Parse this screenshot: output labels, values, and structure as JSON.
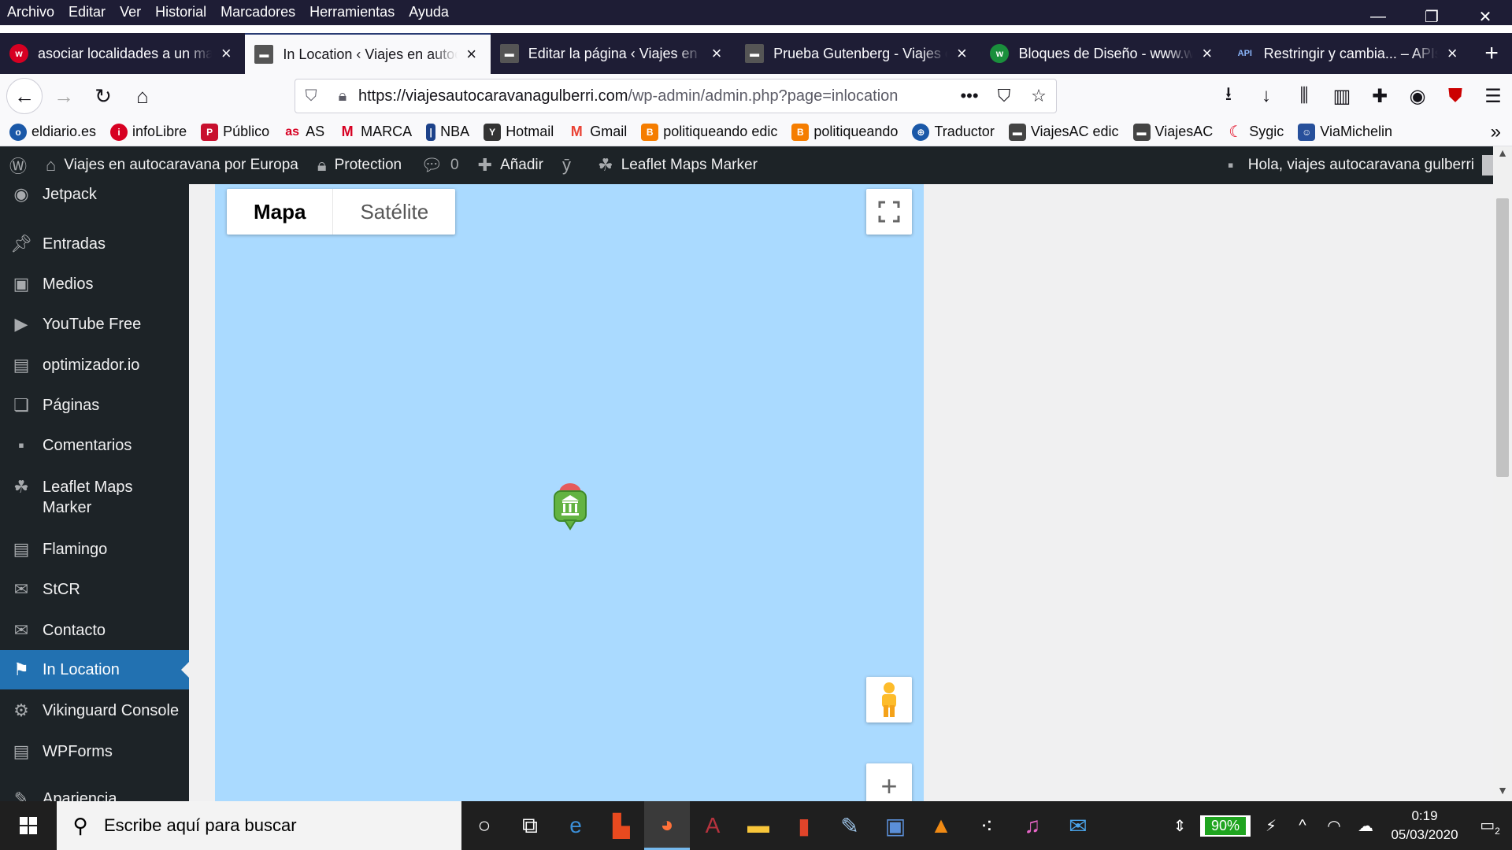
{
  "menubar": {
    "items": [
      "Archivo",
      "Editar",
      "Ver",
      "Historial",
      "Marcadores",
      "Herramientas",
      "Ayuda"
    ],
    "window_controls": [
      "minimize-icon",
      "restore-icon",
      "close-icon"
    ]
  },
  "tabs": [
    {
      "title": "asociar localidades a un mapa",
      "icon": "w-favicon",
      "color": "#d70022",
      "active": false
    },
    {
      "title": "In Location ‹ Viajes en autocaravana",
      "icon": "site-favicon",
      "color": "#555555",
      "active": true
    },
    {
      "title": "Editar la página ‹ Viajes en autocaravana",
      "icon": "site-favicon",
      "color": "#555555",
      "active": false
    },
    {
      "title": "Prueba Gutenberg - Viajes en autocaravana",
      "icon": "site-favicon",
      "color": "#555555",
      "active": false
    },
    {
      "title": "Bloques de Diseño - www.wpbeginner",
      "icon": "w-favicon",
      "color": "#1a8f3c",
      "active": false
    },
    {
      "title": "Restringir y cambia... – APIs",
      "icon": "api-favicon",
      "color": "#4a7bd4",
      "active": false
    }
  ],
  "navbar": {
    "url_domain": "https://viajesautocaravanagulberri.com",
    "url_path": "/wp-admin/admin.php?page=inlocation"
  },
  "bookmarks": [
    {
      "label": "eldiario.es",
      "color": "#1a58a8"
    },
    {
      "label": "infoLibre",
      "color": "#d70022"
    },
    {
      "label": "Público",
      "color": "#c8102e"
    },
    {
      "label": "AS",
      "color": "#d70022"
    },
    {
      "label": "MARCA",
      "color": "#d70022"
    },
    {
      "label": "NBA",
      "color": "#1d428a"
    },
    {
      "label": "Hotmail",
      "color": "#333333"
    },
    {
      "label": "Gmail",
      "color": "#ea4335"
    },
    {
      "label": "politiqueando edic",
      "color": "#f57d00"
    },
    {
      "label": "politiqueando",
      "color": "#f57d00"
    },
    {
      "label": "Traductor",
      "color": "#1a58a8"
    },
    {
      "label": "ViajesAC edic",
      "color": "#444444"
    },
    {
      "label": "ViajesAC",
      "color": "#444444"
    },
    {
      "label": "Sygic",
      "color": "#e2001a"
    },
    {
      "label": "ViaMichelin",
      "color": "#27509b"
    }
  ],
  "adminbar": {
    "site_name": "Viajes en autocaravana por Europa",
    "protection": "Protection",
    "comments_count": "0",
    "add_new": "Añadir",
    "plugin": "Leaflet Maps Marker",
    "greeting": "Hola, viajes autocaravana gulberri"
  },
  "sidebar": {
    "items": [
      {
        "label": "Jetpack",
        "icon": "jetpack-icon"
      },
      {
        "label": "Entradas",
        "icon": "pin-icon"
      },
      {
        "label": "Medios",
        "icon": "media-icon"
      },
      {
        "label": "YouTube Free",
        "icon": "youtube-icon"
      },
      {
        "label": "optimizador.io",
        "icon": "optimizer-icon"
      },
      {
        "label": "Páginas",
        "icon": "pages-icon"
      },
      {
        "label": "Comentarios",
        "icon": "comments-icon"
      },
      {
        "label": "Leaflet Maps Marker",
        "icon": "leaflet-icon"
      },
      {
        "label": "Flamingo",
        "icon": "flamingo-icon"
      },
      {
        "label": "StCR",
        "icon": "mail-icon"
      },
      {
        "label": "Contacto",
        "icon": "mail-icon"
      },
      {
        "label": "In Location",
        "icon": "location-icon",
        "current": true
      },
      {
        "label": "Vikinguard Console",
        "icon": "gear-icon"
      },
      {
        "label": "WPForms",
        "icon": "forms-icon"
      },
      {
        "label": "Apariencia",
        "icon": "appearance-icon"
      }
    ]
  },
  "map": {
    "type_buttons": [
      "Mapa",
      "Satélite"
    ],
    "selected_type": "Mapa",
    "water_color": "#aadaff",
    "marker_icon": "museum-marker-icon"
  },
  "taskbar": {
    "search_placeholder": "Escribe aquí para buscar",
    "apps": [
      "cortana-icon",
      "task-view-icon",
      "edge-icon",
      "office-icon",
      "firefox-icon",
      "access-icon",
      "explorer-icon",
      "app-red-icon",
      "paint-icon",
      "app-blue-icon",
      "vlc-icon",
      "tidal-icon",
      "itunes-icon",
      "mail-icon"
    ],
    "battery": "90%",
    "time": "0:19",
    "date": "05/03/2020",
    "notifications": "2"
  }
}
